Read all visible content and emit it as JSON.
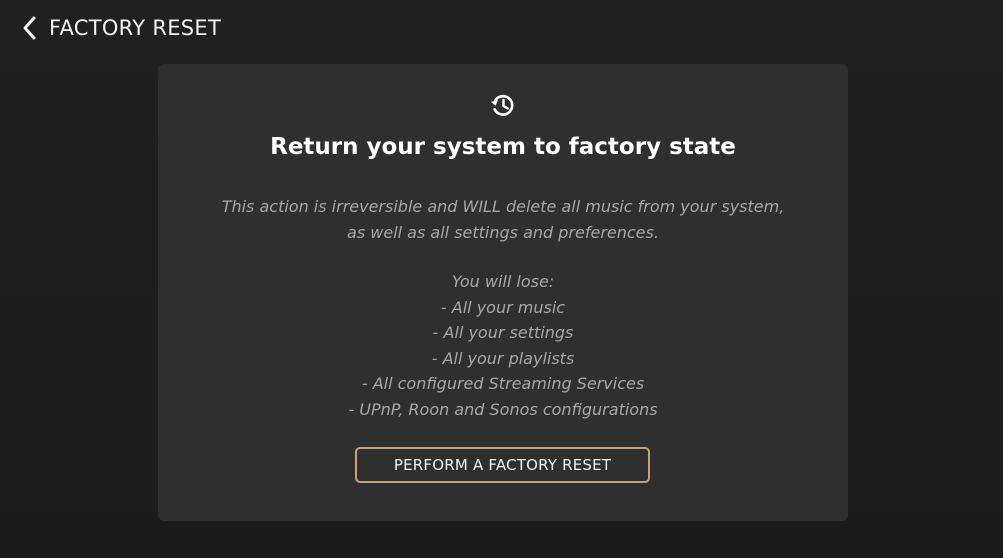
{
  "header": {
    "title": "FACTORY RESET",
    "back_icon": "chevron-left-icon"
  },
  "card": {
    "icon": "history-icon",
    "heading": "Return your system to factory state",
    "warning_lines": [
      "This action is irreversible and WILL delete all music from your system,",
      "as well as all settings and preferences."
    ],
    "lose_title": "You will lose:",
    "lose_items": [
      "- All your music",
      "- All your settings",
      "- All your playlists",
      "- All configured Streaming Services",
      "- UPnP, Roon and Sonos configurations"
    ],
    "button_label": "PERFORM A FACTORY RESET"
  },
  "colors": {
    "background": "#1e1e1e",
    "card": "#2f2f2f",
    "button_border": "#c9a27b",
    "muted_text": "#a8a8a8"
  }
}
